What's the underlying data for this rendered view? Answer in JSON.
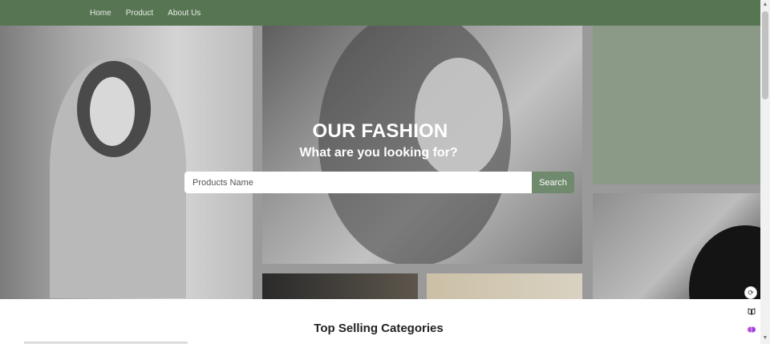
{
  "nav": {
    "items": [
      {
        "label": "Home"
      },
      {
        "label": "Product"
      },
      {
        "label": "About Us"
      }
    ]
  },
  "hero": {
    "title": "OUR FASHION",
    "subtitle": "What are you looking for?",
    "search": {
      "placeholder": "Products Name",
      "value": "",
      "button_label": "Search"
    }
  },
  "sections": {
    "top_selling_title": "Top Selling Categories"
  },
  "widgets": {
    "refresh_icon": "refresh-icon",
    "book_icon": "book-icon",
    "brain_icon": "brain-icon"
  },
  "colors": {
    "navbar": "#577553",
    "accent": "#6f8a6c",
    "hero_tint": "#8b9a86"
  }
}
